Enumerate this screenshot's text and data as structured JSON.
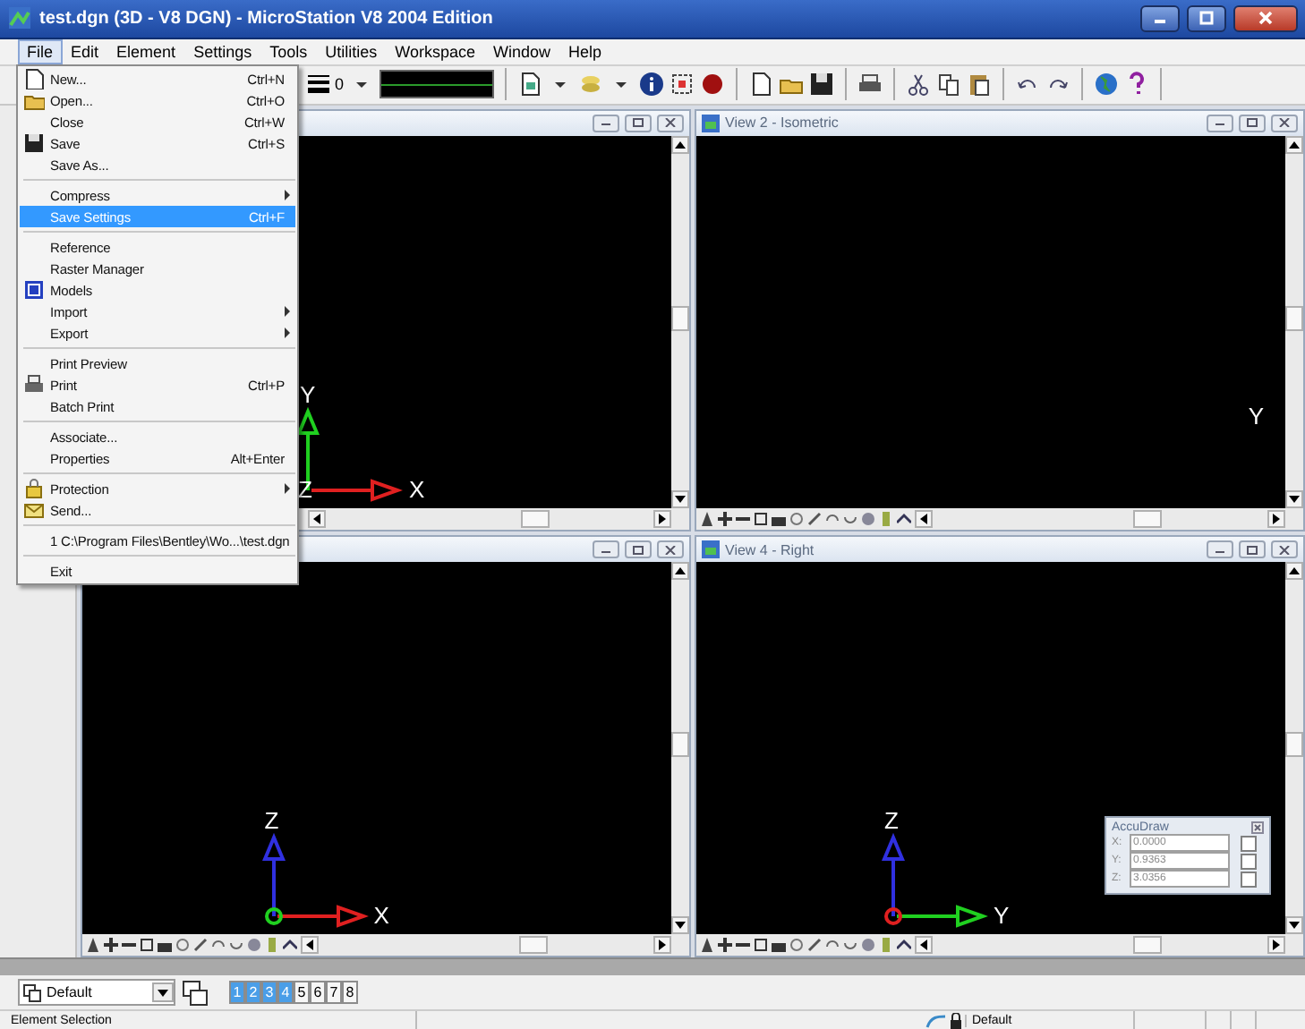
{
  "window": {
    "title": "test.dgn (3D - V8 DGN) - MicroStation V8 2004 Edition"
  },
  "menu_bar": [
    {
      "label": "File",
      "selected": true
    },
    {
      "label": "Edit",
      "selected": false
    },
    {
      "label": "Element",
      "selected": false
    },
    {
      "label": "Settings",
      "selected": false
    },
    {
      "label": "Tools",
      "selected": false
    },
    {
      "label": "Utilities",
      "selected": false
    },
    {
      "label": "Workspace",
      "selected": false
    },
    {
      "label": "Window",
      "selected": false
    },
    {
      "label": "Help",
      "selected": false
    }
  ],
  "toolbar": {
    "line_weight": "0"
  },
  "file_menu": [
    {
      "kind": "item",
      "label": "New...",
      "shortcut": "Ctrl+N",
      "submenu": false,
      "selected": false
    },
    {
      "kind": "item",
      "label": "Open...",
      "shortcut": "Ctrl+O",
      "submenu": false,
      "selected": false
    },
    {
      "kind": "item",
      "label": "Close",
      "shortcut": "Ctrl+W",
      "submenu": false,
      "selected": false
    },
    {
      "kind": "item",
      "label": "Save",
      "shortcut": "Ctrl+S",
      "submenu": false,
      "selected": false
    },
    {
      "kind": "item",
      "label": "Save As...",
      "submenu": false,
      "selected": false
    },
    {
      "kind": "separator"
    },
    {
      "kind": "item",
      "label": "Compress",
      "submenu": true,
      "selected": false
    },
    {
      "kind": "item",
      "label": "Save Settings",
      "shortcut": "Ctrl+F",
      "submenu": false,
      "selected": true
    },
    {
      "kind": "separator"
    },
    {
      "kind": "item",
      "label": "Reference",
      "submenu": false,
      "selected": false
    },
    {
      "kind": "item",
      "label": "Raster Manager",
      "submenu": false,
      "selected": false
    },
    {
      "kind": "item",
      "label": "Models",
      "submenu": false,
      "selected": false
    },
    {
      "kind": "item",
      "label": "Import",
      "submenu": true,
      "selected": false
    },
    {
      "kind": "item",
      "label": "Export",
      "submenu": true,
      "selected": false
    },
    {
      "kind": "separator"
    },
    {
      "kind": "item",
      "label": "Print Preview",
      "submenu": false,
      "selected": false
    },
    {
      "kind": "item",
      "label": "Print",
      "shortcut": "Ctrl+P",
      "submenu": false,
      "selected": false
    },
    {
      "kind": "item",
      "label": "Batch Print",
      "submenu": false,
      "selected": false
    },
    {
      "kind": "separator"
    },
    {
      "kind": "item",
      "label": "Associate...",
      "submenu": false,
      "selected": false
    },
    {
      "kind": "item",
      "label": "Properties",
      "shortcut": "Alt+Enter",
      "submenu": false,
      "selected": false
    },
    {
      "kind": "separator"
    },
    {
      "kind": "item",
      "label": "Protection",
      "submenu": true,
      "selected": false
    },
    {
      "kind": "item",
      "label": "Send...",
      "submenu": false,
      "selected": false
    },
    {
      "kind": "separator"
    },
    {
      "kind": "item",
      "label": "1 C:\\Program Files\\Bentley\\Wo...\\test.dgn",
      "submenu": false,
      "selected": false
    },
    {
      "kind": "separator"
    },
    {
      "kind": "item",
      "label": "Exit",
      "submenu": false,
      "selected": false
    }
  ],
  "views": [
    {
      "axes": {
        "vertical": {
          "label": "Y",
          "color": "#20d020"
        },
        "horizontal": {
          "label": "X",
          "color": "#e02020"
        },
        "origin": {
          "label": "Z"
        }
      }
    },
    {
      "title": "View 2 - Isometric",
      "edge_label": "Y"
    },
    {
      "axes": {
        "vertical": {
          "label": "Z",
          "color": "#3030e0"
        },
        "horizontal": {
          "label": "X",
          "color": "#e02020"
        },
        "origin": {
          "color": "#20d020"
        }
      }
    },
    {
      "title": "View 4 - Right",
      "axes": {
        "vertical": {
          "label": "Z",
          "color": "#3030e0"
        },
        "horizontal": {
          "label": "Y",
          "color": "#20d020"
        },
        "origin": {
          "color": "#e02020"
        }
      }
    }
  ],
  "accudraw": {
    "title": "AccuDraw",
    "fields": [
      {
        "label": "X:",
        "value": "0.0000",
        "locked": false
      },
      {
        "label": "Y:",
        "value": "0.9363",
        "locked": false
      },
      {
        "label": "Z:",
        "value": "3.0356",
        "locked": false
      }
    ]
  },
  "view_bar": {
    "view_set": "Default",
    "view_buttons": [
      {
        "label": "1",
        "selected": true
      },
      {
        "label": "2",
        "selected": true
      },
      {
        "label": "3",
        "selected": true
      },
      {
        "label": "4",
        "selected": true
      },
      {
        "label": "5",
        "selected": false
      },
      {
        "label": "6",
        "selected": false
      },
      {
        "label": "7",
        "selected": false
      },
      {
        "label": "8",
        "selected": false
      }
    ]
  },
  "status_bar": {
    "message": "Element Selection",
    "level": "Default"
  }
}
